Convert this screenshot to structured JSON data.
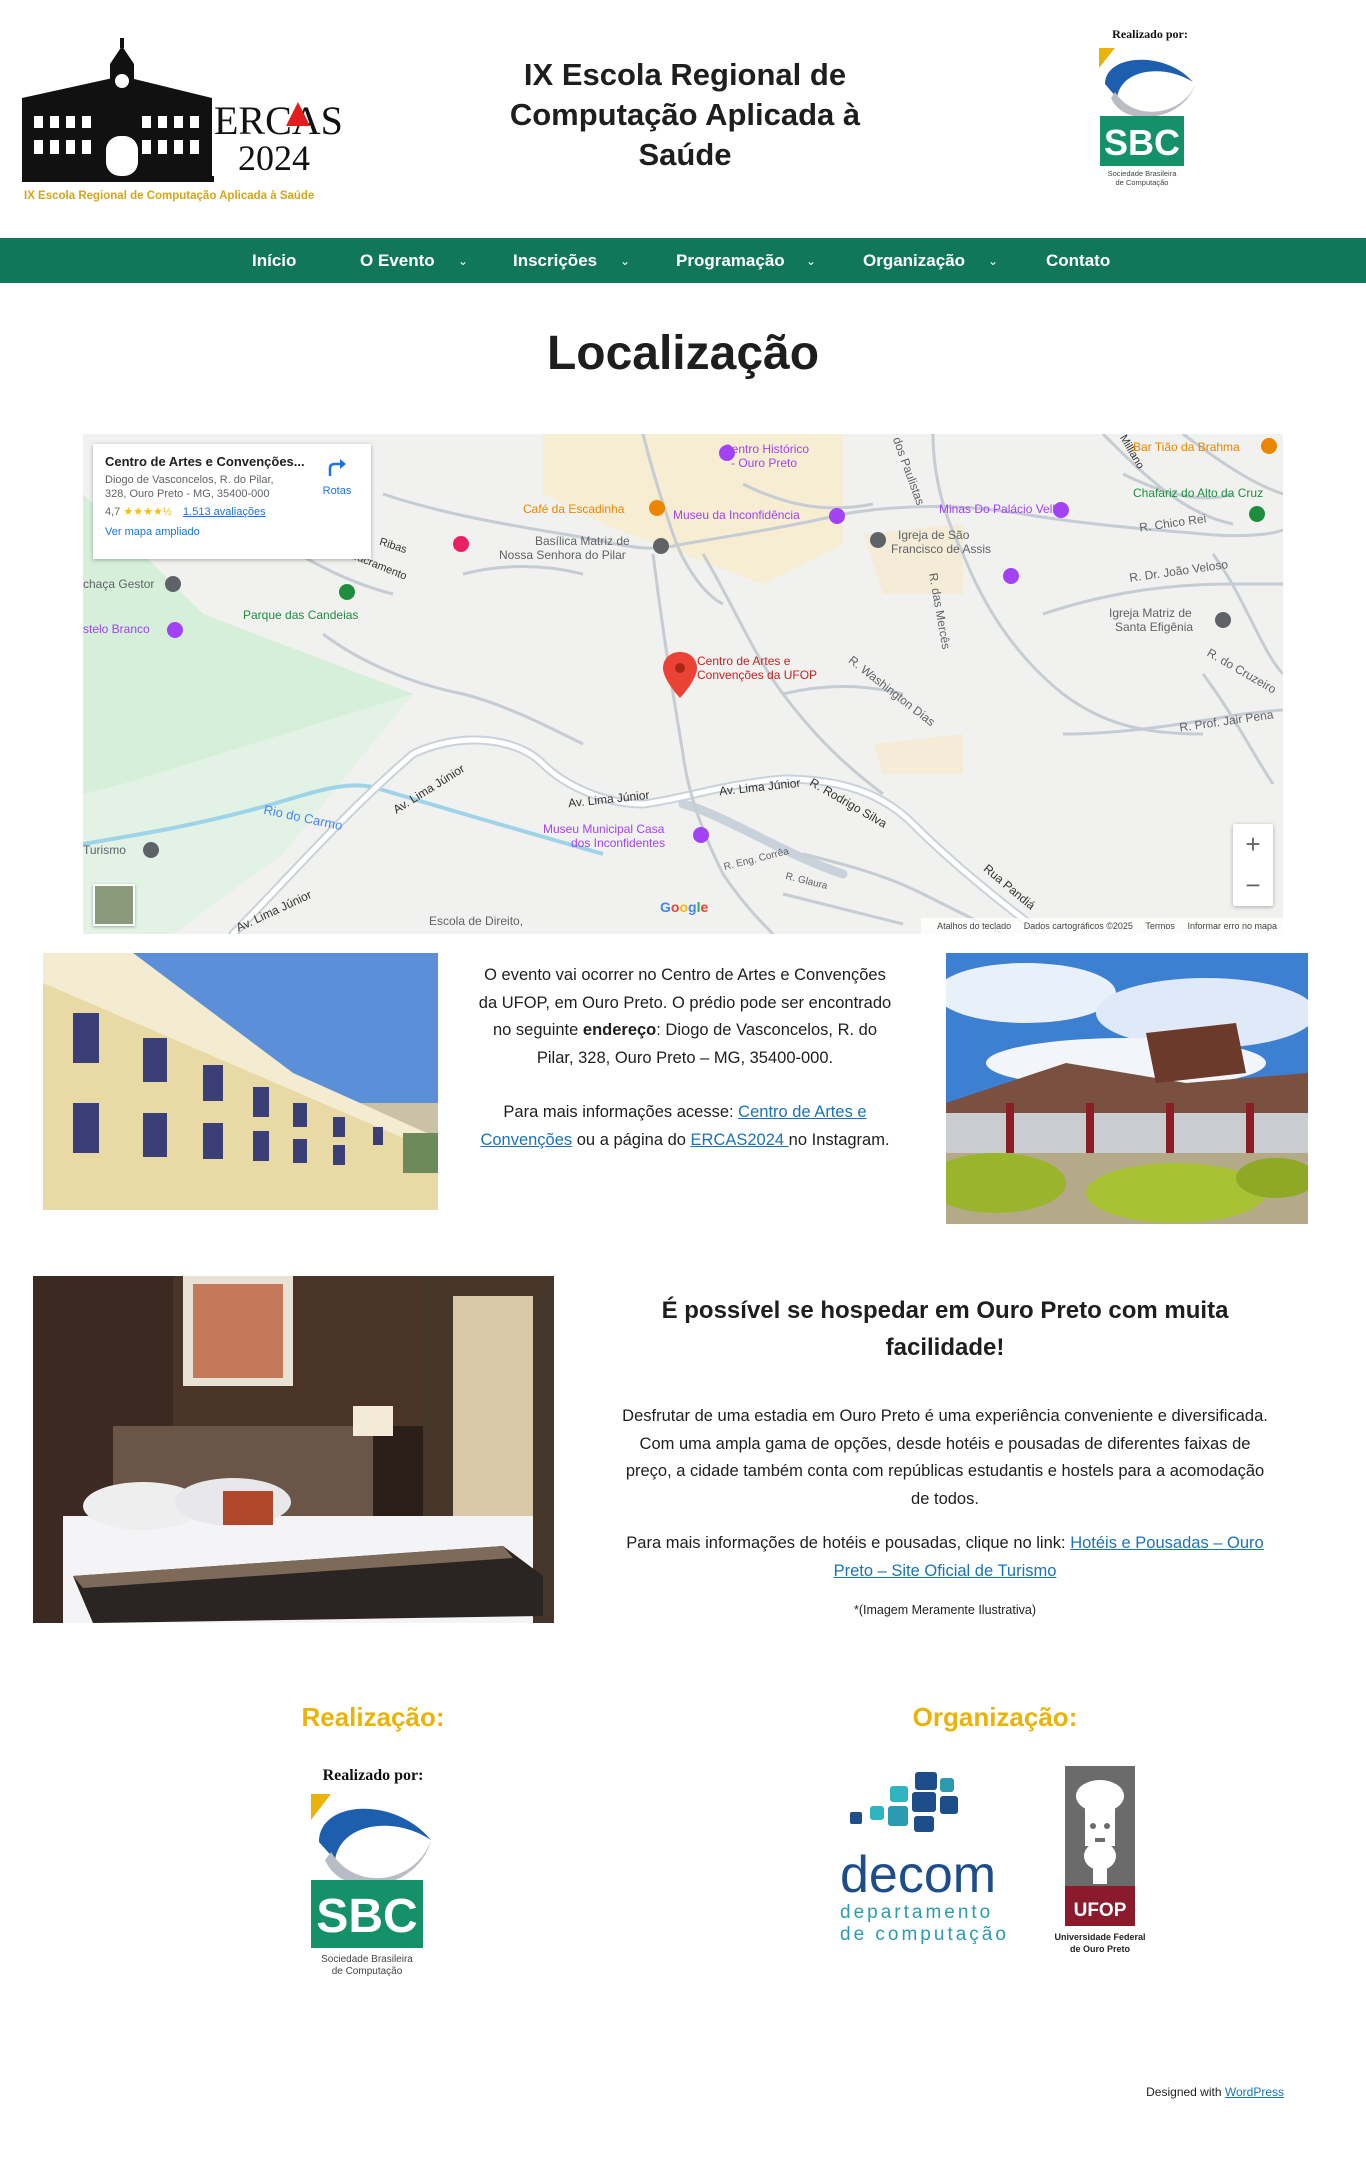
{
  "header": {
    "site_title": "IX Escola Regional de Computação Aplicada à Saúde",
    "logo": {
      "wordmark_line1": "ERCAS",
      "wordmark_line2": "2024",
      "subtitle": "IX Escola Regional de Computação Aplicada à Saúde"
    },
    "sponsor_logo": {
      "realizado": "Realizado por:",
      "acronym": "SBC",
      "name_line1": "Sociedade Brasileira",
      "name_line2": "de Computação"
    }
  },
  "nav": {
    "items": [
      {
        "label": "Início",
        "dropdown": false
      },
      {
        "label": "O Evento",
        "dropdown": true
      },
      {
        "label": "Inscrições",
        "dropdown": true
      },
      {
        "label": "Programação",
        "dropdown": true
      },
      {
        "label": "Organização",
        "dropdown": true
      },
      {
        "label": "Contato",
        "dropdown": false
      }
    ],
    "chevron": "⌄"
  },
  "page": {
    "title": "Localização"
  },
  "map": {
    "card": {
      "title": "Centro de Artes e Convenções...",
      "address": "Diogo de Vasconcelos, R. do Pilar, 328, Ouro Preto - MG, 35400-000",
      "rating": "4,7",
      "stars": "★★★★½",
      "reviews": "1.513 avaliações",
      "larger_map": "Ver mapa ampliado",
      "directions": "Rotas"
    },
    "pin_label_line1": "Centro de Artes e",
    "pin_label_line2": "Convenções da UFOP",
    "labels": {
      "centro_historico_1": "Centro Histórico",
      "centro_historico_2": "- Ouro Preto",
      "bar_tiao": "Bar Tião da Brahma",
      "chafariz": "Chafariz do Alto da Cruz",
      "cafe": "Café da Escadinha",
      "museu_inconf": "Museu da Inconfidência",
      "minas_palacio": "Minas Do Palácio Velho",
      "basilica_1": "Basílica Matriz de",
      "basilica_2": "Nossa Senhora do Pilar",
      "igreja_sao_francisco_1": "Igreja de São",
      "igreja_sao_francisco_2": "Francisco de Assis",
      "chico_rei": "R. Chico Rei",
      "joao_veloso": "R. Dr. João Veloso",
      "cachaca": "chaça Gestor",
      "parque": "Parque das Candeias",
      "castelo": "stelo Branco",
      "santa_efigenia_1": "Igreja Matriz de",
      "santa_efigenia_2": "Santa Efigênia",
      "cruzeiro": "R. do Cruzeiro",
      "washington": "R. Washington Dias",
      "jair_pena": "R. Prof. Jair Pena",
      "merces": "R. das Mercês",
      "paulistas": "dos Paulistas",
      "lima_junior_1": "Av. Lima Júnior",
      "lima_junior_2": "Av. Lima Júnior",
      "lima_junior_3": "Av. Lima Júnior",
      "lima_junior_4": "Av. Lima Júnior",
      "rodrigo_silva": "R. Rodrigo Silva",
      "rio_carmo": "Rio do Carmo",
      "museu_casa_1": "Museu Municipal Casa",
      "museu_casa_2": "dos Inconfidentes",
      "eng_correa": "R. Eng. Corrêa",
      "glaura": "R. Glaura",
      "pandia": "Rua Pandiá",
      "turismo": "Turismo",
      "escola_direito": "Escola de Direito,",
      "ribas": "Ribas",
      "sacramento": "Sacramento",
      "milliano": "Milliano"
    },
    "footer": {
      "google": "Google",
      "keyboard": "Atalhos do teclado",
      "data": "Dados cartográficos ©2025",
      "terms": "Termos",
      "report": "Informar erro no mapa"
    },
    "zoom_in": "+",
    "zoom_out": "−"
  },
  "location": {
    "p1_a": "O evento vai ocorrer no Centro de Artes e Convenções da UFOP, em Ouro Preto. O prédio pode ser encontrado no seguinte ",
    "p1_bold": "endereço",
    "p1_b": ": Diogo de Vasconcelos, R. do Pilar, 328, Ouro Preto – MG, 35400-000.",
    "p2_a": "Para mais informações acesse: ",
    "p2_link1": "Centro de Artes e Convenções",
    "p2_b": " ou a página do ",
    "p2_link2": "ERCAS2024 ",
    "p2_c": "no Instagram."
  },
  "hotel": {
    "heading": "É possível se hospedar em Ouro Preto com muita facilidade!",
    "p1": "Desfrutar de uma estadia em Ouro Preto é uma experiência conveniente e diversificada. Com uma ampla gama de opções, desde hotéis e pousadas de diferentes faixas de preço, a cidade também conta com repúblicas estudantis e hostels para a acomodação de todos.",
    "p2_a": "Para mais informações de hotéis e pousadas, clique no link: ",
    "p2_link": "Hotéis e Pousadas – Ouro Preto – Site Oficial de Turismo",
    "note": "*(Imagem Meramente Ilustrativa)"
  },
  "footer": {
    "realizacao": "Realização:",
    "organizacao": "Organização:",
    "decom_big": "decom",
    "decom_l1": "departamento",
    "decom_l2": "de computação",
    "ufop": "UFOP",
    "ufop_l1": "Universidade Federal",
    "ufop_l2": "de Ouro Preto",
    "credits_a": "Designed with ",
    "credits_link": "WordPress"
  },
  "colors": {
    "nav": "#10775d",
    "footer_heading": "#eab308",
    "link": "#1a73b8"
  }
}
